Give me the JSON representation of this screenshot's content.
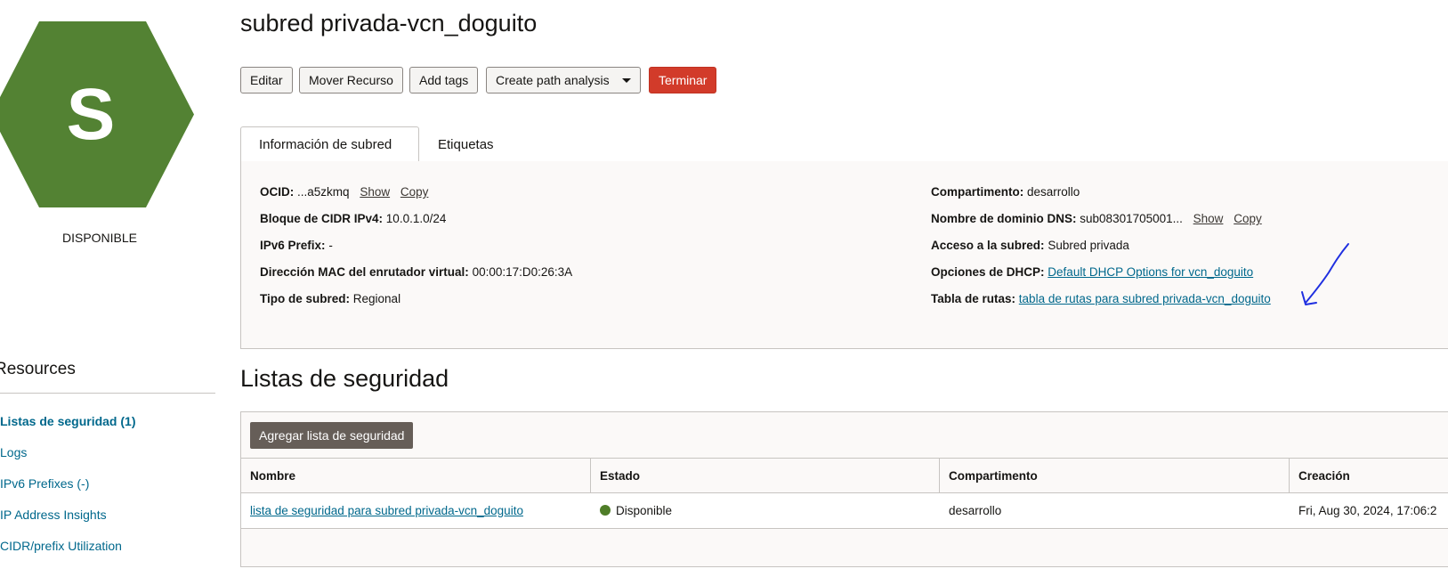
{
  "resource": {
    "icon_letter": "S",
    "icon_color": "#538233",
    "status": "DISPONIBLE",
    "title": "subred privada-vcn_doguito"
  },
  "actions": {
    "edit": "Editar",
    "move": "Mover Recurso",
    "add_tags": "Add tags",
    "path_analysis": "Create path analysis",
    "terminate": "Terminar"
  },
  "tabs": [
    "Información de subred",
    "Etiquetas"
  ],
  "info": {
    "ocid_label": "OCID:",
    "ocid_value": "...a5zkmq",
    "show": "Show",
    "copy": "Copy",
    "cidr_label": "Bloque de CIDR IPv4:",
    "cidr_value": "10.0.1.0/24",
    "ipv6_label": "IPv6 Prefix:",
    "ipv6_value": "-",
    "mac_label": "Dirección MAC del enrutador virtual:",
    "mac_value": "00:00:17:D0:26:3A",
    "type_label": "Tipo de subred:",
    "type_value": "Regional",
    "compartment_label": "Compartimento:",
    "compartment_value": "desarrollo",
    "dns_label": "Nombre de dominio DNS:",
    "dns_value": "sub08301705001...",
    "access_label": "Acceso a la subred:",
    "access_value": "Subred privada",
    "dhcp_label": "Opciones de DHCP:",
    "dhcp_value": "Default DHCP Options for vcn_doguito",
    "route_label": "Tabla de rutas:",
    "route_value": "tabla de rutas para subred privada-vcn_doguito"
  },
  "resources": {
    "title": "Resources",
    "items": [
      "Listas de seguridad (1)",
      "Logs",
      "IPv6 Prefixes (-)",
      "IP Address Insights",
      "CIDR/prefix Utilization"
    ]
  },
  "security_lists": {
    "title": "Listas de seguridad",
    "add_button": "Agregar lista de seguridad",
    "columns": [
      "Nombre",
      "Estado",
      "Compartimento",
      "Creación"
    ],
    "rows": [
      {
        "name": "lista de seguridad para subred privada-vcn_doguito",
        "status": "Disponible",
        "compartment": "desarrollo",
        "created": "Fri, Aug 30, 2024, 17:06:2"
      }
    ]
  }
}
